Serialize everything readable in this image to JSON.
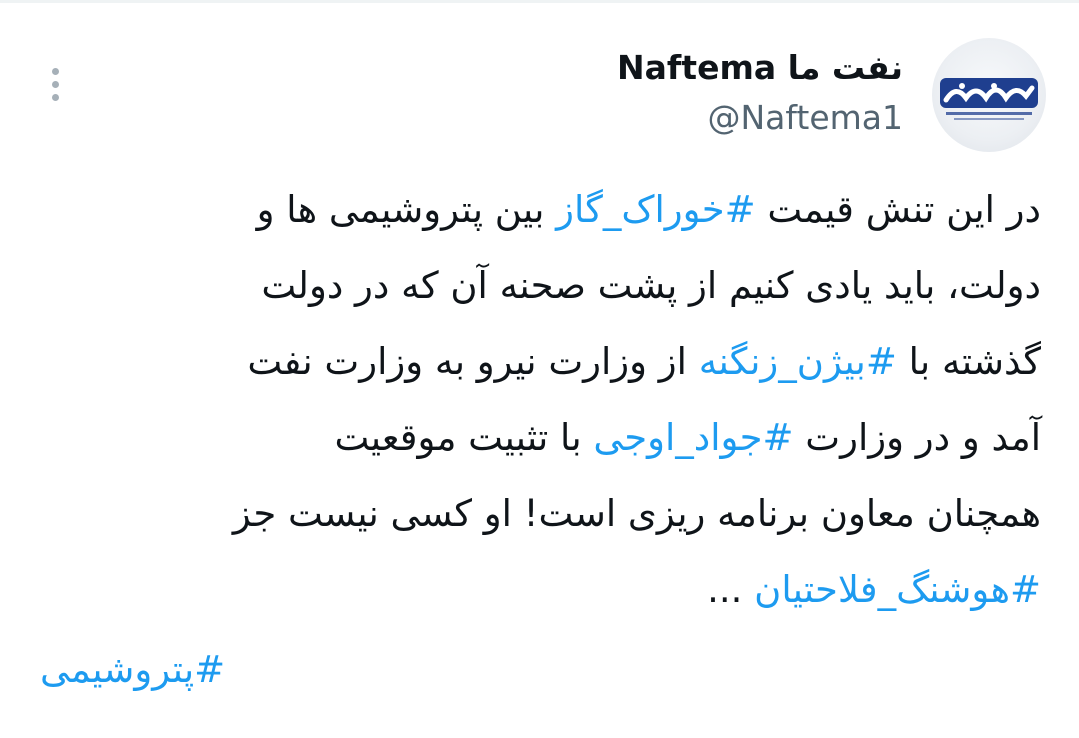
{
  "author": {
    "display_name": "نفت ما Naftema",
    "handle": "@Naftema1",
    "avatar_icon": "naftema-logo-icon"
  },
  "more_icon": "more-vertical-icon",
  "tweet": {
    "lines": [
      [
        {
          "text": "در این تنش قیمت ",
          "hashtag": false
        },
        {
          "text": "#خوراک_گاز",
          "hashtag": true
        },
        {
          "text": " بین پتروشیمی ها و",
          "hashtag": false
        }
      ],
      [
        {
          "text": "دولت، باید یادی کنیم از پشت صحنه آن که در دولت",
          "hashtag": false
        }
      ],
      [
        {
          "text": "گذشته با ",
          "hashtag": false
        },
        {
          "text": "#بیژن_زنگنه",
          "hashtag": true
        },
        {
          "text": " از وزارت نیرو به وزارت نفت",
          "hashtag": false
        }
      ],
      [
        {
          "text": "آمد و در وزارت ",
          "hashtag": false
        },
        {
          "text": "#جواد_اوجی",
          "hashtag": true
        },
        {
          "text": " با تثبیت موقعیت",
          "hashtag": false
        }
      ],
      [
        {
          "text": "همچنان معاون برنامه ریزی است! او کسی نیست جز",
          "hashtag": false
        }
      ],
      [
        {
          "text": "#هوشنگ_فلاحتیان",
          "hashtag": true
        },
        {
          "text": " ...",
          "hashtag": false
        }
      ]
    ],
    "tags": [
      "#پتروشیمی"
    ]
  },
  "colors": {
    "hashtag": "#1d9bf0",
    "text": "#0f1419",
    "secondary": "#536471",
    "logo": "#1f3f8f"
  }
}
